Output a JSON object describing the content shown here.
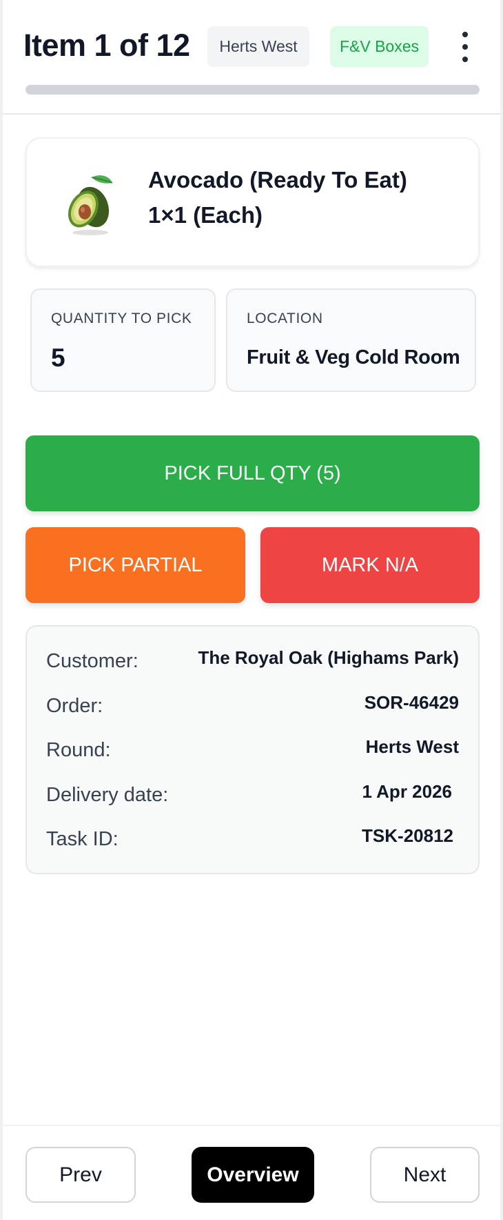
{
  "header": {
    "title": "Item 1 of 12",
    "round_chip": "Herts West",
    "type_chip": "F&V Boxes",
    "progress_fraction": 0
  },
  "product": {
    "name": "Avocado (Ready To Eat)",
    "pack": "1×1 (Each)",
    "image_icon": "avocado-icon"
  },
  "quantity": {
    "label": "QUANTITY TO PICK",
    "value": "5"
  },
  "location": {
    "label": "LOCATION",
    "value": "Fruit & Veg Cold Room"
  },
  "actions": {
    "pick_full": "PICK FULL QTY (5)",
    "pick_partial": "PICK PARTIAL",
    "mark_na": "MARK N/A"
  },
  "details": [
    {
      "key": "Customer:",
      "value": "The Royal Oak (Highams Park)"
    },
    {
      "key": "Order:",
      "value": "SOR-46429"
    },
    {
      "key": "Round:",
      "value": "Herts West"
    },
    {
      "key": "Delivery date:",
      "value": "1 Apr 2026"
    },
    {
      "key": "Task ID:",
      "value": "TSK-20812"
    }
  ],
  "footer": {
    "prev": "Prev",
    "overview": "Overview",
    "next": "Next"
  },
  "colors": {
    "success": "#2bad4a",
    "warning": "#f97020",
    "danger": "#ef4444",
    "chip_green_bg": "#dcfce7",
    "chip_green_text": "#16a34a"
  }
}
